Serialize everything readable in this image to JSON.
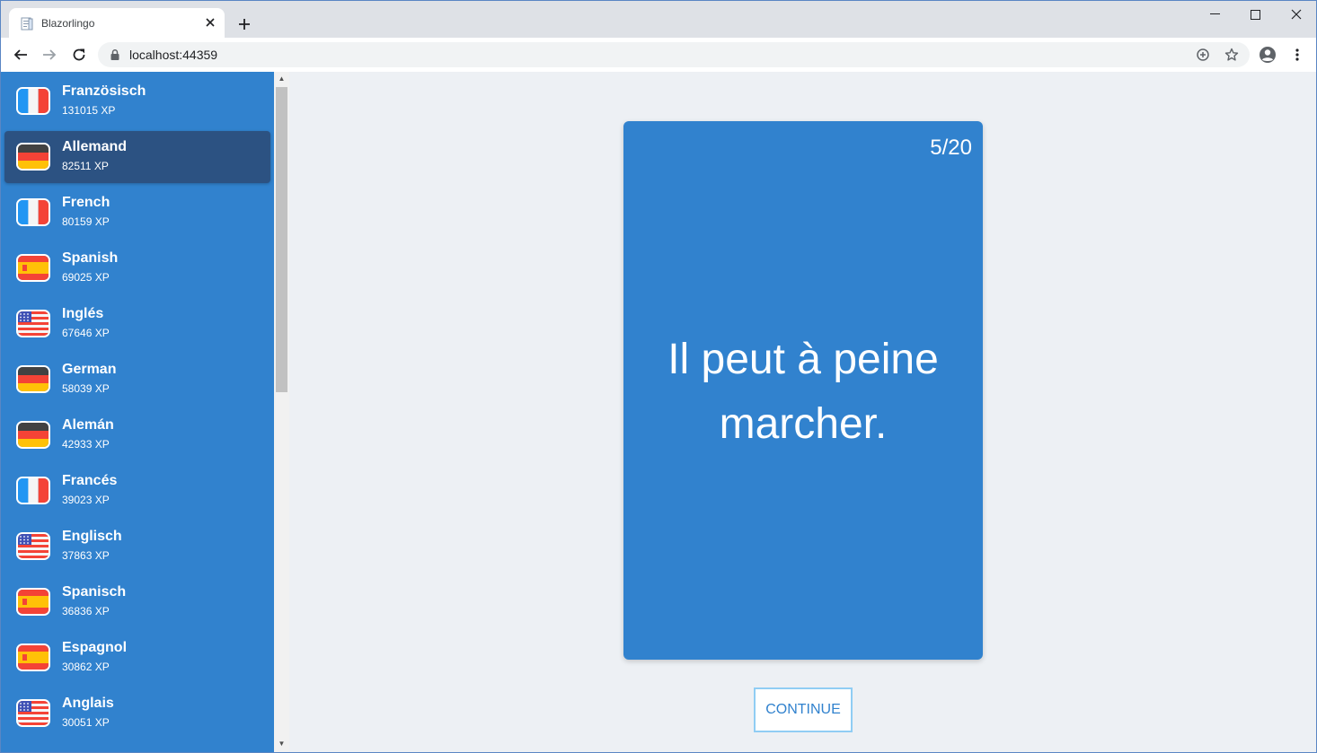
{
  "browser": {
    "tab_title": "Blazorlingo",
    "url": "localhost:44359"
  },
  "sidebar": {
    "items": [
      {
        "name": "Französisch",
        "xp": "131015 XP",
        "flag": "fr",
        "active": false
      },
      {
        "name": "Allemand",
        "xp": "82511 XP",
        "flag": "de",
        "active": true
      },
      {
        "name": "French",
        "xp": "80159 XP",
        "flag": "fr",
        "active": false
      },
      {
        "name": "Spanish",
        "xp": "69025 XP",
        "flag": "es",
        "active": false
      },
      {
        "name": "Inglés",
        "xp": "67646 XP",
        "flag": "us",
        "active": false
      },
      {
        "name": "German",
        "xp": "58039 XP",
        "flag": "de",
        "active": false
      },
      {
        "name": "Alemán",
        "xp": "42933 XP",
        "flag": "de",
        "active": false
      },
      {
        "name": "Francés",
        "xp": "39023 XP",
        "flag": "fr",
        "active": false
      },
      {
        "name": "Englisch",
        "xp": "37863 XP",
        "flag": "us",
        "active": false
      },
      {
        "name": "Spanisch",
        "xp": "36836 XP",
        "flag": "es",
        "active": false
      },
      {
        "name": "Espagnol",
        "xp": "30862 XP",
        "flag": "es",
        "active": false
      },
      {
        "name": "Anglais",
        "xp": "30051 XP",
        "flag": "us",
        "active": false
      }
    ]
  },
  "card": {
    "progress": "5/20",
    "sentence": "Il peut à peine marcher."
  },
  "continue_label": "CONTINUE",
  "colors": {
    "accent": "#3182ce",
    "active_item": "#2c5282",
    "page_bg": "#edf0f4"
  }
}
